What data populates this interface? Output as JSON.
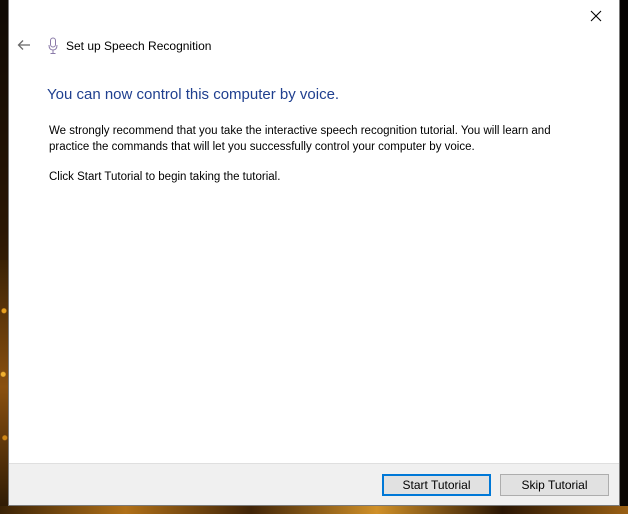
{
  "window": {
    "title": "Set up Speech Recognition"
  },
  "content": {
    "heading": "You can now control this computer by voice.",
    "paragraph1": "We strongly recommend that you take the interactive speech recognition tutorial. You will learn and practice the commands that will let you successfully control your computer by voice.",
    "paragraph2": "Click Start Tutorial to begin taking the tutorial."
  },
  "buttons": {
    "start_tutorial": "Start Tutorial",
    "skip_tutorial": "Skip Tutorial"
  },
  "icons": {
    "back": "back-arrow-icon",
    "microphone": "microphone-icon",
    "close": "close-icon"
  },
  "colors": {
    "heading": "#1f3f8f",
    "primary_border": "#0078d7"
  }
}
